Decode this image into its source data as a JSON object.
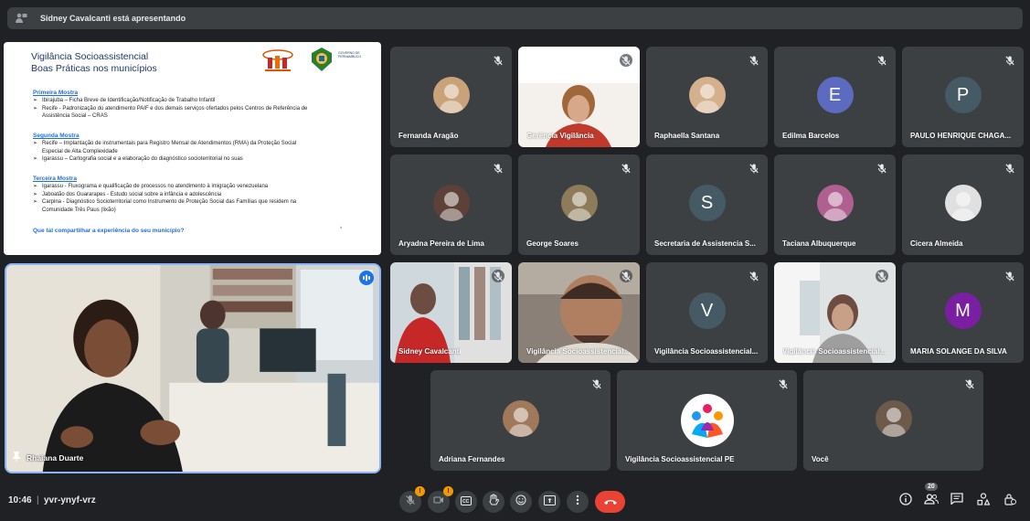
{
  "presenting": {
    "text": "Sidney Cavalcanti está apresentando"
  },
  "slide": {
    "title_line1": "Vigilância Socioassistencial",
    "title_line2": "Boas Práticas nos municípios",
    "logo_text": "GOVERNO DE PERNAMBUCO",
    "sections": [
      {
        "heading": "Primeira Mostra",
        "items": [
          "Ibirajuba – Ficha Breve de Identificação/Notificação de Trabalho Infantil",
          "Recife - Padronização do atendimento PAIF e dos demais serviços ofertados pelos Centros de Referência de Assistência Social – CRAS"
        ]
      },
      {
        "heading": "Segunda Mostra",
        "items": [
          "Recife – Implantação de instrumentais para Registro Mensal de Atendimentos (RMA) da Proteção Social Especial de Alta Complexidade",
          "Igarassu – Cartografia social e a elaboração do diagnóstico socioterritorial no suas"
        ]
      },
      {
        "heading": "Terceira Mostra",
        "items": [
          "Igarassu - Fluxograma e qualificação de processos no atendimento à imigração venezuelana",
          "Jaboatão dos Guararapes - Estudo social sobre a infância e adolescência",
          "Carpina - Diagnóstico Socioterritorial como Instrumento de Proteção Social das Famílias que residem na Comunidade Três Paus (lixão)"
        ]
      }
    ],
    "question": "Que tal compartilhar a experiência do seu município?",
    "footer_mark": "à"
  },
  "speaker": {
    "name": "Rhaiana Duarte"
  },
  "participants": [
    {
      "name": "Fernanda Aragão",
      "type": "photo",
      "color": "#c9a27a"
    },
    {
      "name": "Gerência Vigilância",
      "type": "video"
    },
    {
      "name": "Raphaella Santana",
      "type": "photo",
      "color": "#d4b08c"
    },
    {
      "name": "Edilma Barcelos",
      "type": "letter",
      "letter": "E",
      "color": "#5c6bc0"
    },
    {
      "name": "PAULO HENRIQUE CHAGA...",
      "type": "letter",
      "letter": "P",
      "color": "#455a64"
    },
    {
      "name": "Aryadna Pereira de Lima",
      "type": "photo",
      "color": "#5d4037"
    },
    {
      "name": "George Soares",
      "type": "photo",
      "color": "#8d7b5a"
    },
    {
      "name": "Secretaria de Assistencia S...",
      "type": "letter",
      "letter": "S",
      "color": "#455a64"
    },
    {
      "name": "Taciana Albuquerque",
      "type": "photo",
      "color": "#b06090"
    },
    {
      "name": "Cicera Almeida",
      "type": "photo",
      "color": "#e0e0e0"
    },
    {
      "name": "Sidney Cavalcanti",
      "type": "video"
    },
    {
      "name": "Vigilância Socioassistencial...",
      "type": "video"
    },
    {
      "name": "Vigilância Socioassistencial...",
      "type": "letter",
      "letter": "V",
      "color": "#455a64"
    },
    {
      "name": "Vigilância Socioassistencial...",
      "type": "video"
    },
    {
      "name": "MARIA SOLANGE DA SILVA",
      "type": "letter",
      "letter": "M",
      "color": "#7b1fa2"
    },
    {
      "name": "Adriana Fernandes",
      "type": "photo",
      "color": "#a0785a"
    },
    {
      "name": "Vigilância Socioassistencial PE",
      "type": "logo"
    },
    {
      "name": "Você",
      "type": "photo",
      "color": "#6d5a4a"
    }
  ],
  "bottom": {
    "time": "10:46",
    "separator": "|",
    "meeting_code": "yvr-ynyf-vrz",
    "mic_badge": "!",
    "cam_badge": "!",
    "participant_count": "20"
  },
  "colors": {
    "accent": "#8ab4f8",
    "end_call": "#ea4335",
    "warning": "#f29900",
    "tile": "#3c4043",
    "bg": "#202124"
  },
  "icons": [
    "present-hand-icon",
    "mic-off-icon",
    "camera-off-icon",
    "captions-icon",
    "raise-hand-icon",
    "emoji-icon",
    "present-screen-icon",
    "more-options-icon",
    "end-call-icon",
    "info-icon",
    "people-icon",
    "chat-icon",
    "activities-icon",
    "host-controls-icon"
  ]
}
